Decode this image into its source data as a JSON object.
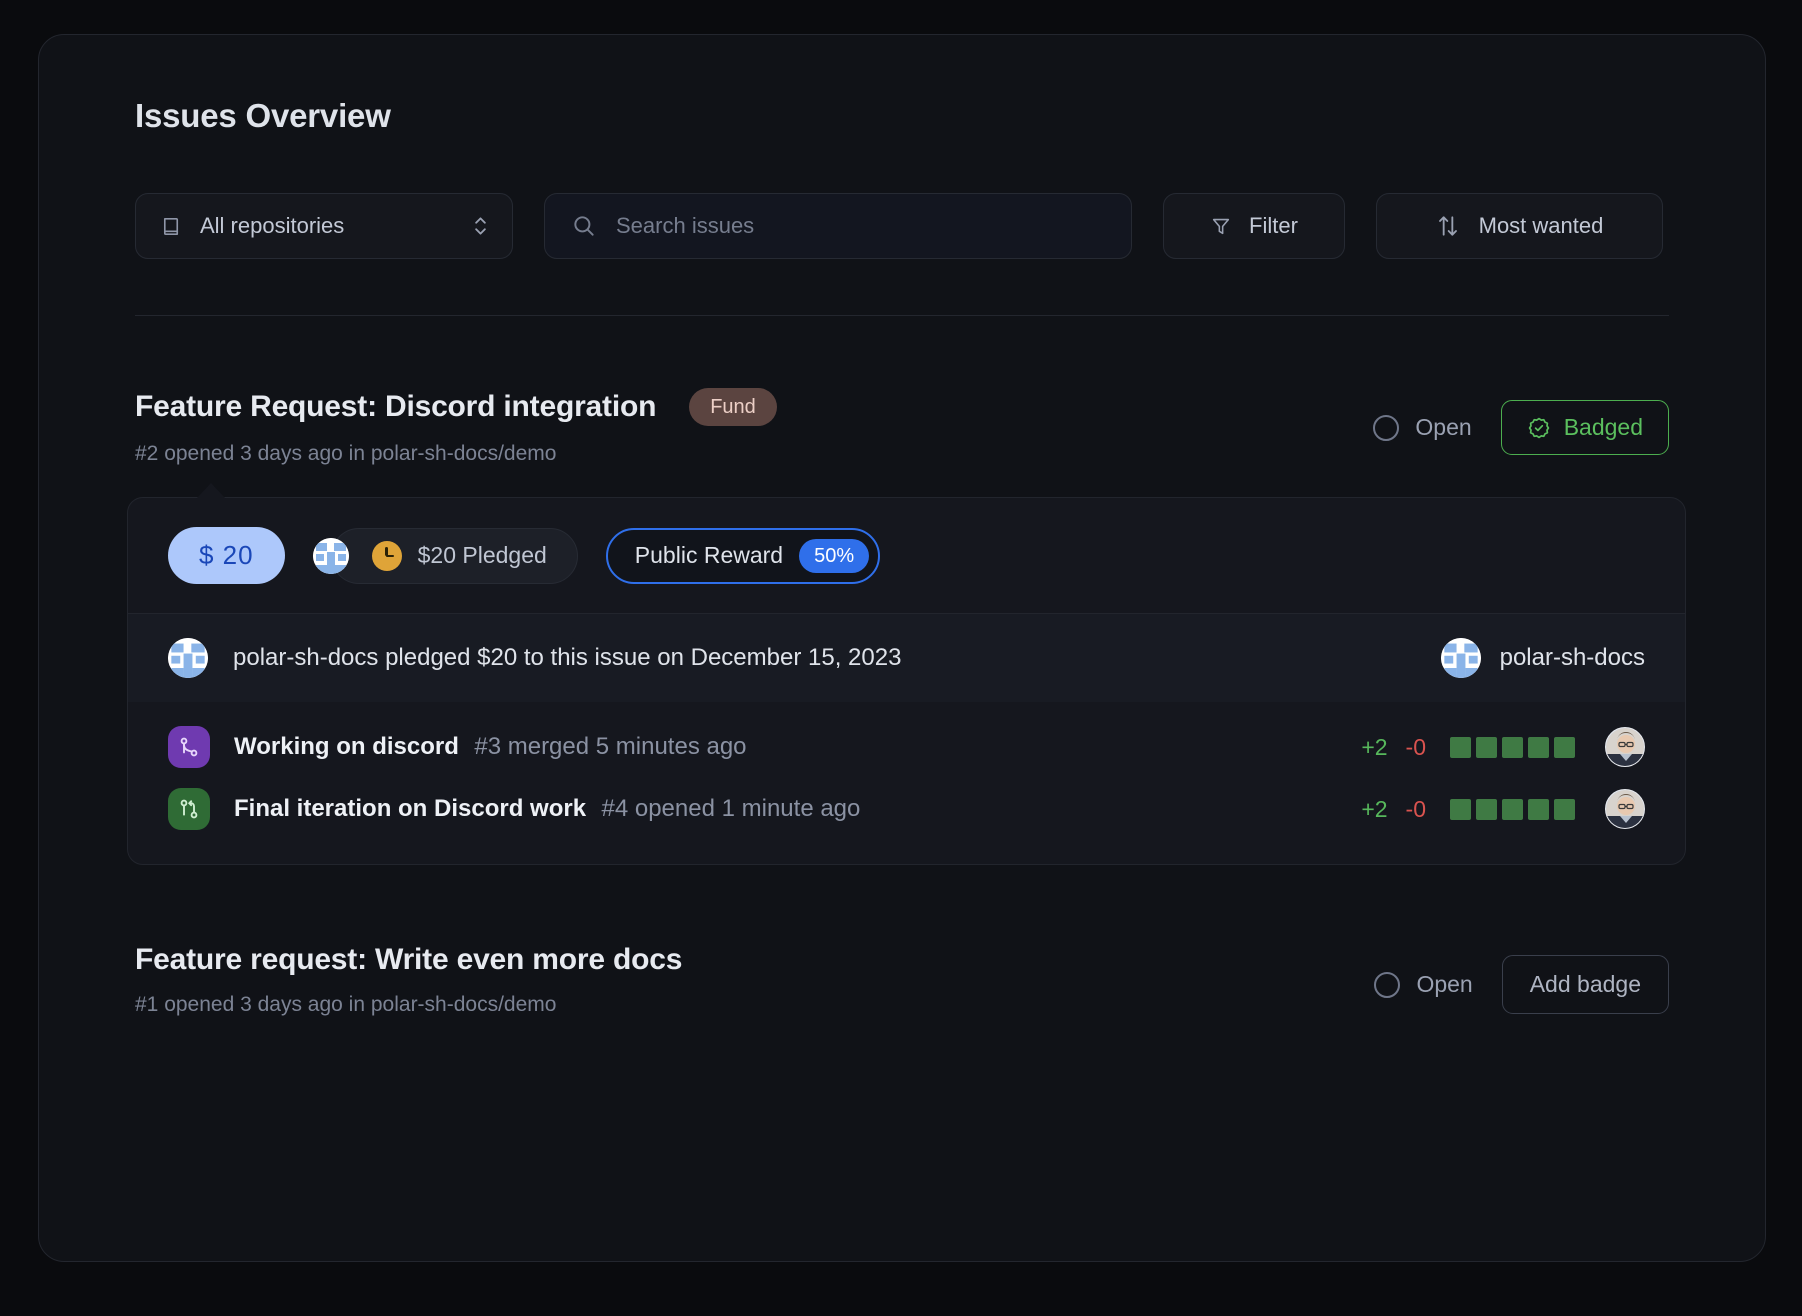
{
  "page": {
    "title": "Issues Overview"
  },
  "toolbar": {
    "repo_select": {
      "icon": "repo-book-icon",
      "label": "All repositories",
      "chevron": "chevron-up-down-icon"
    },
    "search": {
      "icon": "search-icon",
      "value": "",
      "placeholder": "Search issues"
    },
    "filter_button": {
      "icon": "filter-funnel-icon",
      "label": "Filter"
    },
    "sort_button": {
      "icon": "sort-arrows-icon",
      "label": "Most wanted"
    }
  },
  "issues": [
    {
      "title": "Feature Request: Discord integration",
      "fund_label": "Fund",
      "meta": "#2 opened 3 days ago in polar-sh-docs/demo",
      "state_label": "Open",
      "action_label": "Badged",
      "action_icon": "verified-check-icon",
      "action_style": "badged",
      "pledge_panel": {
        "amount_pill": "$ 20",
        "pledged_chip": {
          "icon": "clock-icon",
          "avatar": "polar-sh-docs-avatar",
          "label": "$20 Pledged"
        },
        "reward_pill": {
          "label": "Public Reward",
          "badge": "50%"
        },
        "activity": {
          "avatar": "polar-sh-docs-avatar",
          "text": "polar-sh-docs pledged $20 to this issue on December 15, 2023",
          "org_avatar": "polar-sh-docs-avatar",
          "org_name": "polar-sh-docs"
        },
        "pull_requests": [
          {
            "icon": "pull-request-merged-icon",
            "state": "merged",
            "title": "Working on discord",
            "meta": "#3 merged 5 minutes ago",
            "additions": "+2",
            "deletions": "-0",
            "diff_squares": 5,
            "avatar": "contributor-avatar"
          },
          {
            "icon": "pull-request-open-icon",
            "state": "open",
            "title": "Final iteration on Discord work",
            "meta": "#4 opened 1 minute ago",
            "additions": "+2",
            "deletions": "-0",
            "diff_squares": 5,
            "avatar": "contributor-avatar"
          }
        ]
      }
    },
    {
      "title": "Feature request: Write even more docs",
      "fund_label": null,
      "meta": "#1 opened 3 days ago in polar-sh-docs/demo",
      "state_label": "Open",
      "action_label": "Add badge",
      "action_icon": null,
      "action_style": "outline",
      "pledge_panel": null
    }
  ],
  "colors": {
    "page_bg": "#0a0b0e",
    "card_bg": "#101217",
    "border": "#23262e",
    "accent_blue": "#2f6fea",
    "amount_pill_bg": "#adc8fb",
    "amount_pill_text": "#1a47b8",
    "badged_green": "#5bbf5e",
    "fund_pill_bg": "#5b4440",
    "fund_pill_text": "#eccfc6",
    "additions_green": "#57b85c",
    "deletions_red": "#d9534f",
    "diff_square": "#3f7a44",
    "merged_purple": "#6f3ab0",
    "open_green": "#2f6b35",
    "clock_orange": "#dfa438"
  }
}
